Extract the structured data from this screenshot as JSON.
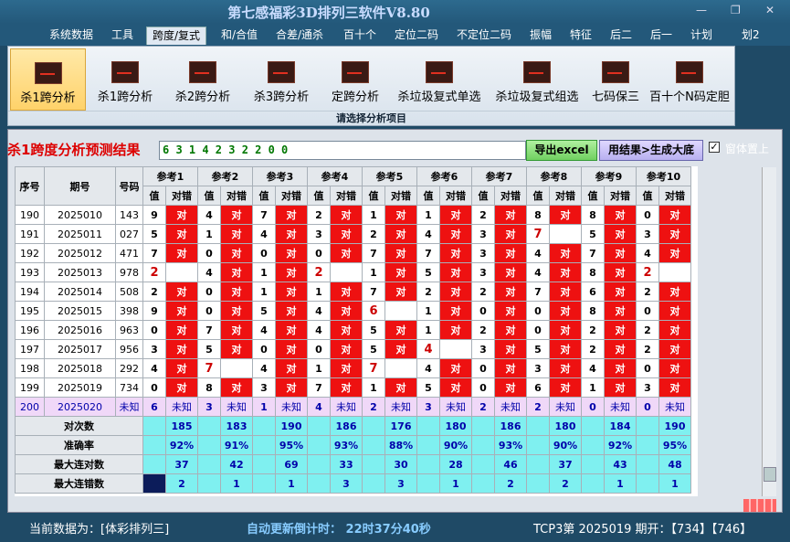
{
  "title": "第七感福彩3D排列三软件V8.80",
  "window": {
    "minimize": "—",
    "restore": "❐",
    "close": "✕"
  },
  "menu": [
    "系统数据",
    "工具",
    "跨度/复式",
    "和/合值",
    "合差/通杀",
    "百十个",
    "定位二码",
    "不定位二码",
    "振幅",
    "特征",
    "后二",
    "后一",
    "计划",
    "划2"
  ],
  "ribbon": {
    "buttons": [
      "杀1跨分析",
      "杀1跨分析",
      "杀2跨分析",
      "杀3跨分析",
      "定跨分析",
      "杀垃圾复式单选",
      "杀垃圾复式组选",
      "七码保三",
      "百十个N码定胆"
    ],
    "footer": "请选择分析项目"
  },
  "result": {
    "label": "杀1跨度分析预测结果",
    "value": "6 3 1 4 2 3 2 2 0 0",
    "excel_btn": "导出excel",
    "gen_btn": "用结果>生成大底",
    "checkbox": "✓",
    "checkbox_label": "窗体置上"
  },
  "table": {
    "headers": {
      "seq": "序号",
      "issue": "期号",
      "num": "号码",
      "ref": [
        "参考1",
        "参考2",
        "参考3",
        "参考4",
        "参考5",
        "参考6",
        "参考7",
        "参考8",
        "参考9",
        "参考10"
      ],
      "val": "值",
      "hit": "对错"
    },
    "hit_text": "对",
    "rows": [
      {
        "seq": "190",
        "issue": "2025010",
        "num": "143",
        "v": [
          "9",
          "4",
          "7",
          "2",
          "1",
          "1",
          "2",
          "8",
          "8",
          "0"
        ],
        "h": [
          1,
          1,
          1,
          1,
          1,
          1,
          1,
          1,
          1,
          1
        ],
        "big": [
          0,
          0,
          0,
          0,
          0,
          0,
          0,
          0,
          0,
          0
        ]
      },
      {
        "seq": "191",
        "issue": "2025011",
        "num": "027",
        "v": [
          "5",
          "1",
          "4",
          "3",
          "2",
          "4",
          "3",
          "7",
          "5",
          "3"
        ],
        "h": [
          1,
          1,
          1,
          1,
          1,
          1,
          1,
          0,
          1,
          1
        ],
        "big": [
          0,
          0,
          0,
          0,
          0,
          0,
          0,
          1,
          0,
          0
        ]
      },
      {
        "seq": "192",
        "issue": "2025012",
        "num": "471",
        "v": [
          "7",
          "0",
          "0",
          "0",
          "7",
          "7",
          "3",
          "4",
          "7",
          "4"
        ],
        "h": [
          1,
          1,
          1,
          1,
          1,
          1,
          1,
          1,
          1,
          1
        ],
        "big": [
          0,
          0,
          0,
          0,
          0,
          0,
          0,
          0,
          0,
          0
        ]
      },
      {
        "seq": "193",
        "issue": "2025013",
        "num": "978",
        "v": [
          "2",
          "4",
          "1",
          "2",
          "1",
          "5",
          "3",
          "4",
          "8",
          "2"
        ],
        "h": [
          0,
          1,
          1,
          0,
          1,
          1,
          1,
          1,
          1,
          0
        ],
        "big": [
          1,
          0,
          0,
          1,
          0,
          0,
          0,
          0,
          0,
          1
        ]
      },
      {
        "seq": "194",
        "issue": "2025014",
        "num": "508",
        "v": [
          "2",
          "0",
          "1",
          "1",
          "7",
          "2",
          "2",
          "7",
          "6",
          "2"
        ],
        "h": [
          1,
          1,
          1,
          1,
          1,
          1,
          1,
          1,
          1,
          1
        ],
        "big": [
          0,
          0,
          0,
          0,
          0,
          0,
          0,
          0,
          0,
          0
        ]
      },
      {
        "seq": "195",
        "issue": "2025015",
        "num": "398",
        "v": [
          "9",
          "0",
          "5",
          "4",
          "6",
          "1",
          "0",
          "0",
          "8",
          "0"
        ],
        "h": [
          1,
          1,
          1,
          1,
          0,
          1,
          1,
          1,
          1,
          1
        ],
        "big": [
          0,
          0,
          0,
          0,
          1,
          0,
          0,
          0,
          0,
          0
        ]
      },
      {
        "seq": "196",
        "issue": "2025016",
        "num": "963",
        "v": [
          "0",
          "7",
          "4",
          "4",
          "5",
          "1",
          "2",
          "0",
          "2",
          "2"
        ],
        "h": [
          1,
          1,
          1,
          1,
          1,
          1,
          1,
          1,
          1,
          1
        ],
        "big": [
          0,
          0,
          0,
          0,
          0,
          0,
          0,
          0,
          0,
          0
        ]
      },
      {
        "seq": "197",
        "issue": "2025017",
        "num": "956",
        "v": [
          "3",
          "5",
          "0",
          "0",
          "5",
          "4",
          "3",
          "5",
          "2",
          "2"
        ],
        "h": [
          1,
          1,
          1,
          1,
          1,
          0,
          1,
          1,
          1,
          1
        ],
        "big": [
          0,
          0,
          0,
          0,
          0,
          1,
          0,
          0,
          0,
          0
        ]
      },
      {
        "seq": "198",
        "issue": "2025018",
        "num": "292",
        "v": [
          "4",
          "7",
          "4",
          "1",
          "7",
          "4",
          "0",
          "3",
          "4",
          "0"
        ],
        "h": [
          1,
          0,
          1,
          1,
          0,
          1,
          1,
          1,
          1,
          1
        ],
        "big": [
          0,
          1,
          0,
          0,
          1,
          0,
          0,
          0,
          0,
          0
        ]
      },
      {
        "seq": "199",
        "issue": "2025019",
        "num": "734",
        "v": [
          "0",
          "8",
          "3",
          "7",
          "1",
          "5",
          "0",
          "6",
          "1",
          "3"
        ],
        "h": [
          1,
          1,
          1,
          1,
          1,
          1,
          1,
          1,
          1,
          1
        ],
        "big": [
          0,
          0,
          0,
          0,
          0,
          0,
          0,
          0,
          0,
          0
        ]
      }
    ],
    "future": {
      "seq": "200",
      "issue": "2025020",
      "num": "未知",
      "v": [
        "6",
        "3",
        "1",
        "4",
        "2",
        "3",
        "2",
        "2",
        "0",
        "0"
      ],
      "unknown": "未知"
    },
    "stats": [
      {
        "label": "对次数",
        "vals": [
          "185",
          "183",
          "190",
          "186",
          "176",
          "180",
          "186",
          "180",
          "184",
          "190"
        ]
      },
      {
        "label": "准确率",
        "vals": [
          "92%",
          "91%",
          "95%",
          "93%",
          "88%",
          "90%",
          "93%",
          "90%",
          "92%",
          "95%"
        ]
      },
      {
        "label": "最大连对数",
        "vals": [
          "37",
          "42",
          "69",
          "33",
          "30",
          "28",
          "46",
          "37",
          "43",
          "48"
        ]
      },
      {
        "label": "最大连错数",
        "vals": [
          "2",
          "1",
          "1",
          "3",
          "3",
          "1",
          "2",
          "2",
          "1",
          "1"
        ]
      }
    ]
  },
  "status": {
    "current": "当前数据为：[体彩排列三]",
    "countdown": "自动更新倒计时： 22时37分40秒",
    "draw": "TCP3第 2025019 期开：【734】【746】"
  }
}
